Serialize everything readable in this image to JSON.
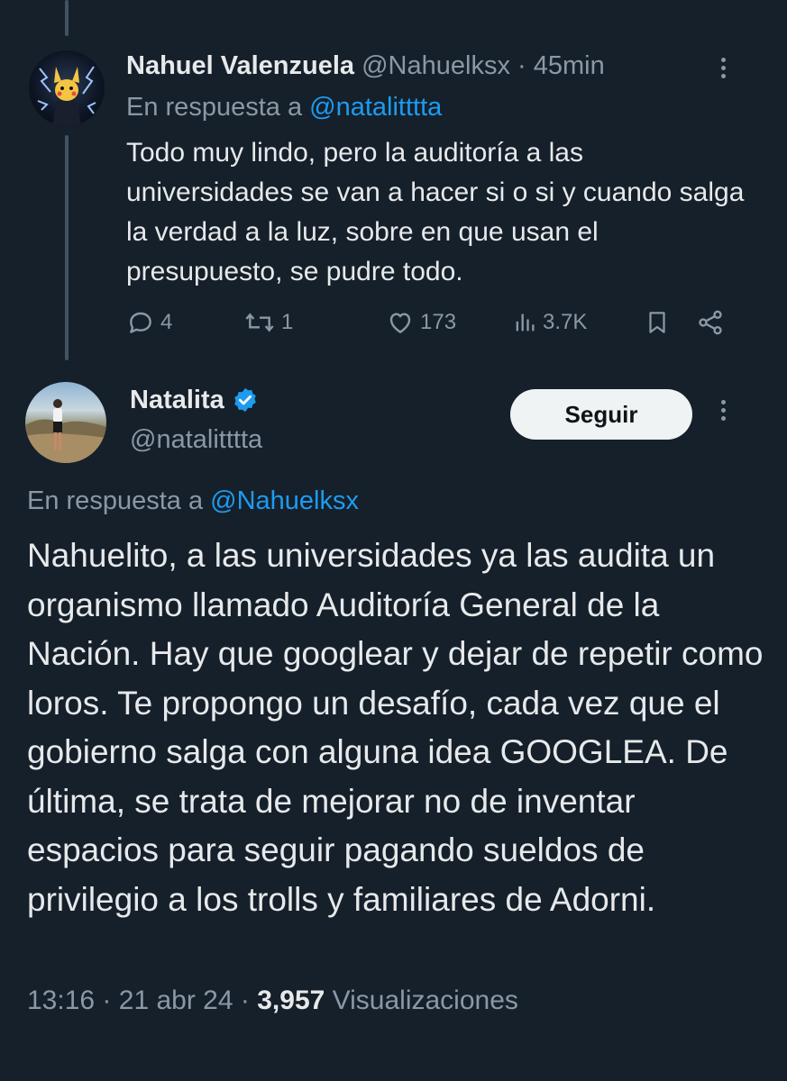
{
  "tweet1": {
    "author_name": "Nahuel Valenzuela",
    "handle": "@Nahuelksx",
    "separator": "·",
    "time": "45min",
    "reply_prefix": "En respuesta a",
    "reply_to": "@natalitttta",
    "body": "Todo muy lindo, pero la auditoría a las universidades se van a hacer si o si y cuando salga la verdad a la luz, sobre en que usan el presupuesto, se pudre todo.",
    "actions": {
      "replies": "4",
      "retweets": "1",
      "likes": "173",
      "views": "3.7K"
    },
    "icons": [
      "reply-icon",
      "retweet-icon",
      "like-icon",
      "views-icon",
      "bookmark-icon",
      "share-icon",
      "more-icon"
    ]
  },
  "tweet2": {
    "author_name": "Natalita",
    "handle": "@natalitttta",
    "follow_label": "Seguir",
    "reply_prefix": "En respuesta a",
    "reply_to": "@Nahuelksx",
    "body": "Nahuelito, a las universidades ya las audita un organismo llamado Auditoría General de la Nación. Hay que googlear y dejar de repetir como loros. Te propongo un desafío, cada vez que el gobierno salga con alguna idea GOOGLEA. De última, se trata de mejorar no de inventar espacios para seguir pagando sueldos de privilegio a los trolls y familiares de Adorni.",
    "time": "13:16",
    "date": "21 abr 24",
    "views_count": "3,957",
    "views_label": "Visualizaciones",
    "separator": "·"
  },
  "colors": {
    "background": "#15202b",
    "text": "#e7e9ea",
    "muted": "#8b98a5",
    "link": "#1d9bf0",
    "verified": "#1d9bf0"
  }
}
